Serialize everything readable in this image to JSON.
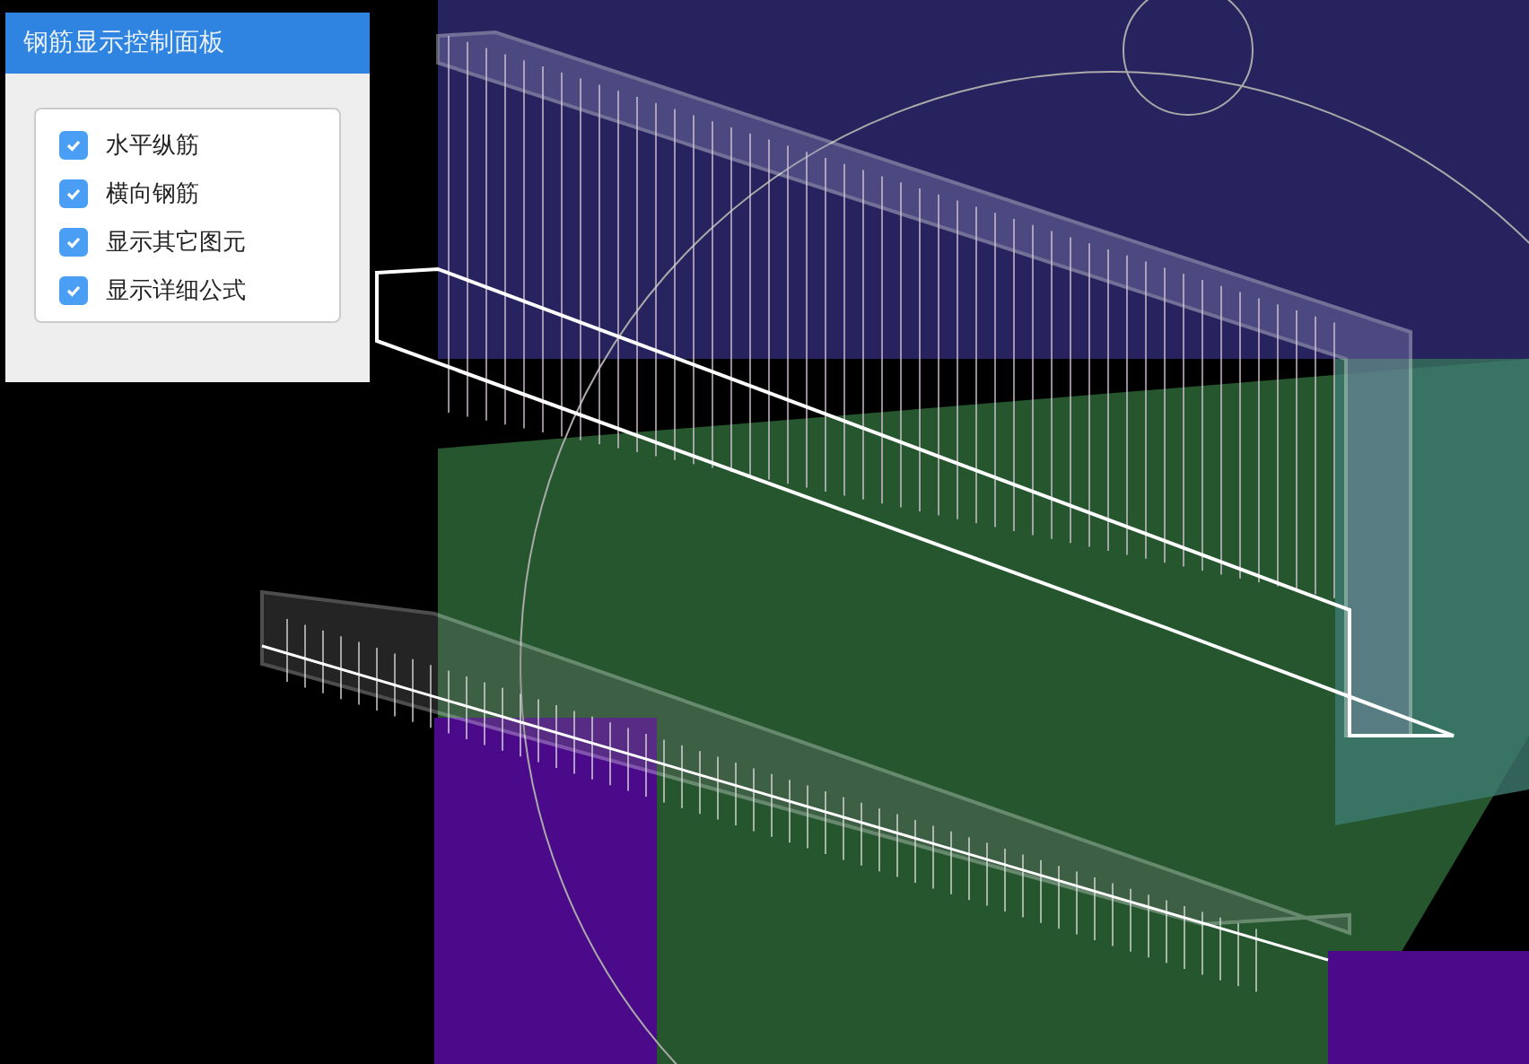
{
  "panel": {
    "title": "钢筋显示控制面板",
    "options": [
      {
        "label": "水平纵筋",
        "checked": true
      },
      {
        "label": "横向钢筋",
        "checked": true
      },
      {
        "label": "显示其它图元",
        "checked": true
      },
      {
        "label": "显示详细公式",
        "checked": true
      }
    ]
  }
}
